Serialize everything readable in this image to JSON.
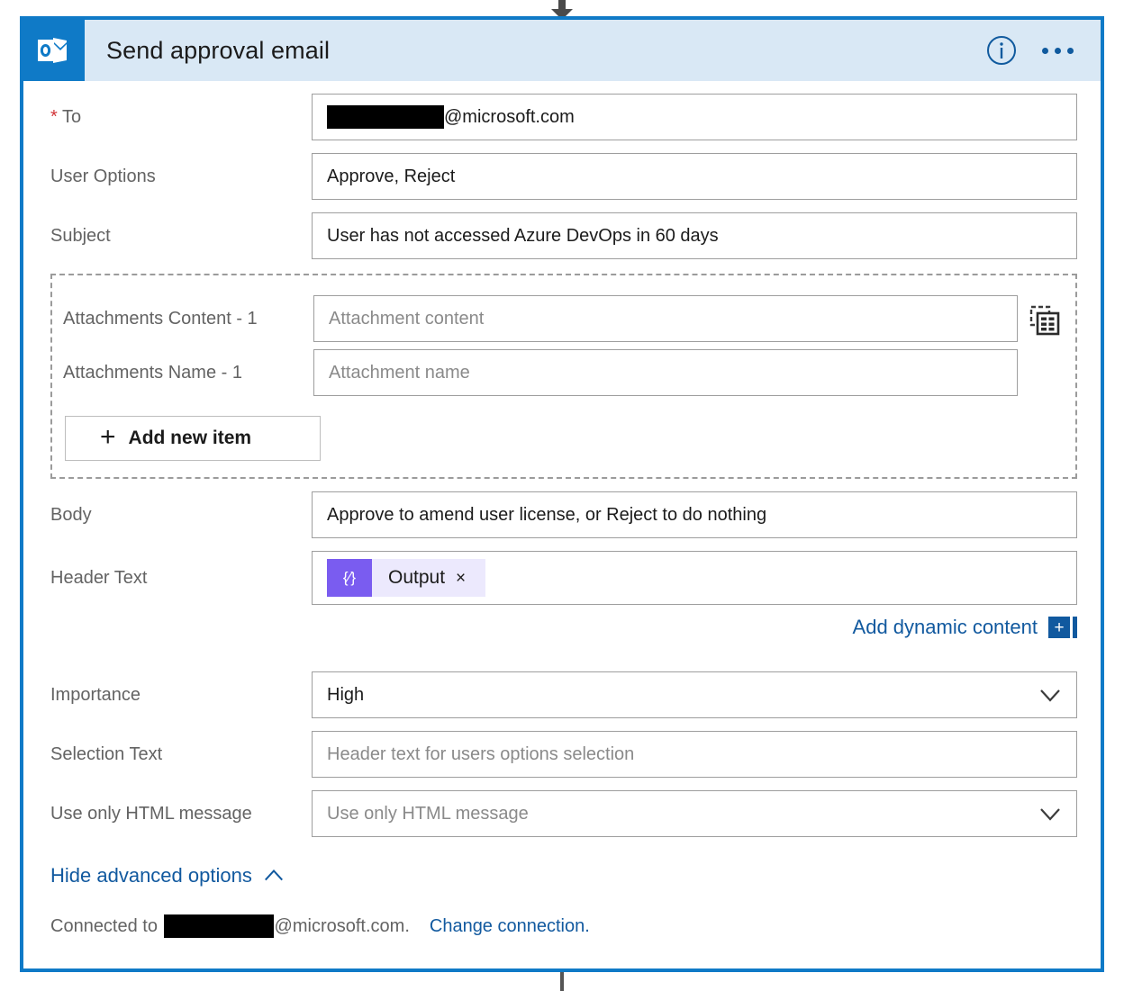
{
  "card": {
    "app_icon": "outlook-icon",
    "title": "Send approval email",
    "info_icon": "info-icon",
    "more_icon": "ellipsis-icon"
  },
  "connector": {
    "top_icon": "down-arrow-icon",
    "bottom_icon": "vertical-line"
  },
  "fields": {
    "to": {
      "label": "To",
      "required_marker": "*",
      "redacted_width": 130,
      "value_suffix": "@microsoft.com"
    },
    "user_options": {
      "label": "User Options",
      "value": "Approve, Reject"
    },
    "subject": {
      "label": "Subject",
      "value": "User has not accessed Azure DevOps in 60 days"
    },
    "body": {
      "label": "Body",
      "value": "Approve to amend user license, or Reject to do nothing"
    },
    "header_text": {
      "label": "Header Text",
      "token_label": "Output",
      "token_icon": "expression-icon",
      "token_icon_glyph": "{⁄}",
      "token_close": "×"
    },
    "importance": {
      "label": "Importance",
      "value": "High",
      "chevron": "chevron-down-icon"
    },
    "selection_text": {
      "label": "Selection Text",
      "placeholder": "Header text for users options selection"
    },
    "use_only_html": {
      "label": "Use only HTML message",
      "placeholder": "Use only HTML message",
      "chevron": "chevron-down-icon"
    }
  },
  "attachments": {
    "array_toggle_icon": "switch-to-array-input-icon",
    "content_row": {
      "label": "Attachments Content - 1",
      "placeholder": "Attachment content"
    },
    "name_row": {
      "label": "Attachments Name - 1",
      "placeholder": "Attachment name"
    },
    "add_item_label": "Add new item",
    "add_item_icon": "plus-icon"
  },
  "dynamic_content": {
    "link_label": "Add dynamic content",
    "plus_glyph": "+",
    "icon": "add-dynamic-content-icon"
  },
  "footer": {
    "advanced_label": "Hide advanced options",
    "advanced_icon": "chevron-up-icon",
    "connected_prefix": "Connected to",
    "connected_redacted_width": 122,
    "connected_suffix": "@microsoft.com.",
    "change_connection": "Change connection."
  },
  "colors": {
    "card_border": "#0f7ac7",
    "header_band": "#d9e8f5",
    "app_tile": "#0f7ac7",
    "link": "#11599f",
    "required": "#d13438",
    "token_icon": "#7a5cf0",
    "token_body": "#ece9fd",
    "label_text": "#636363",
    "placeholder_text": "#8a8a8a"
  }
}
